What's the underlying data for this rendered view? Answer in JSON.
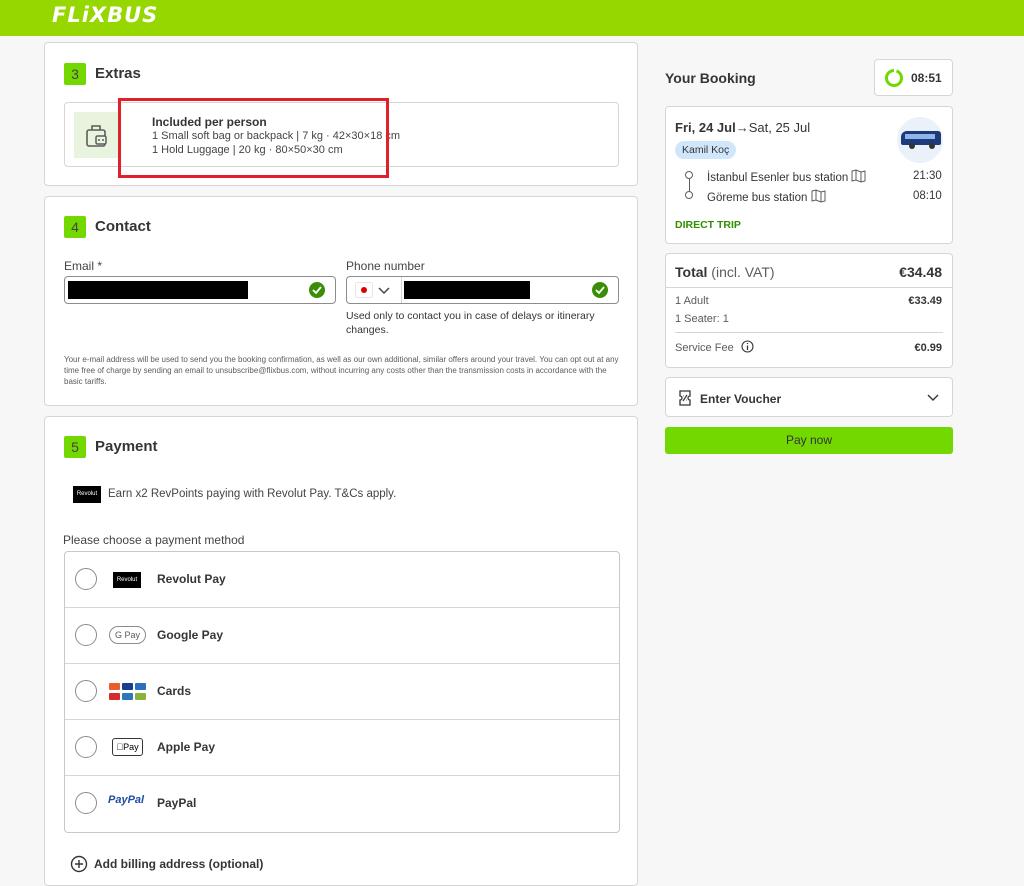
{
  "brand": {
    "logo": "FLiXBUS"
  },
  "extras": {
    "step": "3",
    "title": "Extras",
    "luggage_title": "Included per person",
    "luggage_line1": "1 Small soft bag or backpack | 7 kg · 42×30×18 cm",
    "luggage_line2": "1 Hold Luggage | 20 kg · 80×50×30 cm"
  },
  "contact": {
    "step": "4",
    "title": "Contact",
    "email_label": "Email *",
    "phone_label": "Phone number",
    "phone_hint": "Used only to contact you in case of delays or itinerary changes.",
    "disclaimer": "Your e-mail address will be used to send you the booking confirmation, as well as our own additional, similar offers around your travel. You can opt out at any time free of charge by sending an email to unsubscribe@flixbus.com, without incurring any costs other than the transmission costs in accordance with the basic tariffs."
  },
  "payment": {
    "step": "5",
    "title": "Payment",
    "revolut_promo": "Earn x2 RevPoints paying with Revolut Pay. T&Cs apply.",
    "revolut_badge": "Revolut",
    "choose_label": "Please choose a payment method",
    "methods": [
      {
        "label": "Revolut Pay",
        "icon": "Revolut"
      },
      {
        "label": "Google Pay",
        "icon": "G Pay"
      },
      {
        "label": "Cards",
        "icon": "cards"
      },
      {
        "label": "Apple Pay",
        "icon": "Pay"
      },
      {
        "label": "PayPal",
        "icon": "PayPal"
      }
    ],
    "billing_label": "Add billing address (optional)"
  },
  "booking": {
    "title": "Your Booking",
    "timer": "08:51",
    "date_from": "Fri, 24 Jul",
    "arrow": "→",
    "date_to": "Sat, 25 Jul",
    "operator": "Kamil Koç",
    "from_station": "İstanbul Esenler bus station",
    "from_time": "21:30",
    "to_station": "Göreme bus station",
    "to_time": "08:10",
    "trip_type": "DIRECT TRIP"
  },
  "summary": {
    "total_label": "Total",
    "total_note": "(incl. VAT)",
    "total_value": "€34.48",
    "adult_label": "1 Adult",
    "adult_value": "€33.49",
    "seater_label": "1 Seater: 1",
    "service_label": "Service Fee",
    "service_value": "€0.99"
  },
  "voucher": {
    "label": "Enter Voucher"
  },
  "pay_button": "Pay now",
  "colors": {
    "brand_green": "#97d700",
    "button_green": "#73d700",
    "highlight_red": "#e0202a",
    "success_green": "#3b8d07",
    "direct_trip": "#2f8f00"
  }
}
